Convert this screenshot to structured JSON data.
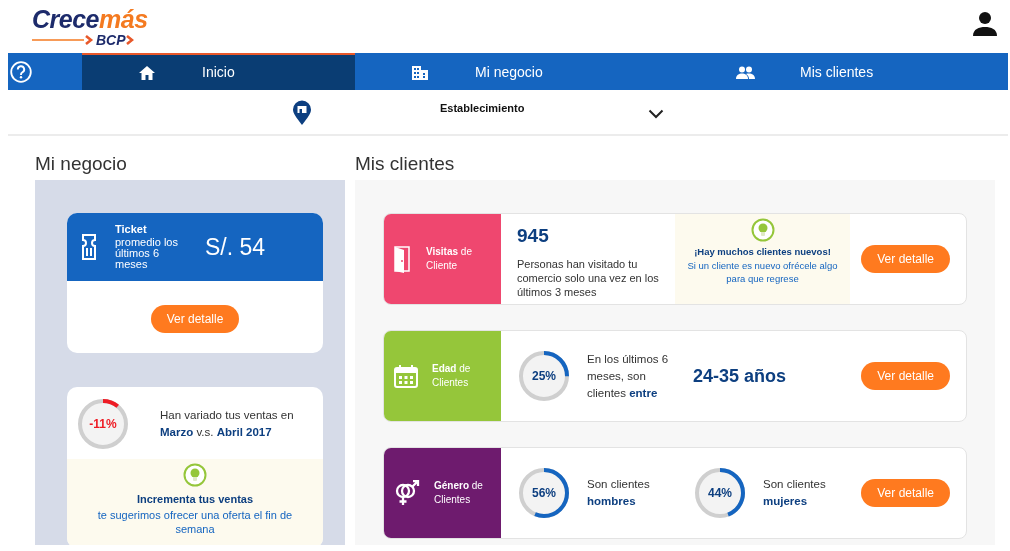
{
  "header": {
    "logo": {
      "first": "Crece",
      "second": "más",
      "sub": "BCP"
    }
  },
  "nav": {
    "tabs": [
      {
        "kind": "home",
        "label": "Inicio",
        "selected": true
      },
      {
        "kind": "building",
        "label": "Mi negocio",
        "selected": false
      },
      {
        "kind": "people",
        "label": "Mis clientes",
        "selected": false
      }
    ]
  },
  "filter": {
    "label": "Establecimiento"
  },
  "mi_negocio": {
    "title": "Mi negocio",
    "ticket": {
      "title": "Ticket",
      "subtitle": "promedio los últimos 6 meses",
      "value": "S/. 54",
      "button": "Ver detalle"
    },
    "sales": {
      "gauge": {
        "level": 0.11,
        "reading": "-11%",
        "color": "#ee1c25"
      },
      "text": "Han variado tus ventas en **Marzo** v.s. **Abril 2017**",
      "tip": {
        "title": "Incrementa tus ventas",
        "text": "te sugerimos ofrecer una oferta el fin de semana"
      }
    }
  },
  "mis_clientes": {
    "title": "Mis clientes",
    "cards": [
      {
        "kind": "door",
        "color": "#ef476f",
        "label": "**Visitas** de Cliente",
        "button": "Ver detalle",
        "items": [
          {
            "kind": "stat",
            "value": "945",
            "text": "Personas han visitado tu comercio solo una vez en los últimos 3 meses"
          },
          {
            "kind": "tip",
            "title": "¡Hay muchos clientes nuevos!",
            "text": "Si un cliente es nuevo ofrécele algo para que regrese"
          }
        ]
      },
      {
        "kind": "calendar",
        "color": "#95c63a",
        "label": "**Edad** de Clientes",
        "button": "Ver detalle",
        "items": [
          {
            "kind": "gauge",
            "level": 0.25,
            "reading": "25%",
            "color": "#1565c0",
            "text": "En los últimos 6 meses, son clientes **entre**"
          },
          {
            "kind": "highlight",
            "text": "**24-35 años**"
          }
        ]
      },
      {
        "kind": "gender",
        "color": "#6e1b6e",
        "label": "**Género** de Clientes",
        "button": "Ver detalle",
        "items": [
          {
            "kind": "gauge",
            "level": 0.56,
            "reading": "56%",
            "color": "#1565c0",
            "text": "Son clientes **hombres**"
          },
          {
            "kind": "gauge",
            "level": 0.44,
            "reading": "44%",
            "color": "#1565c0",
            "text": "Son clientes **mujeres**"
          }
        ]
      }
    ]
  }
}
